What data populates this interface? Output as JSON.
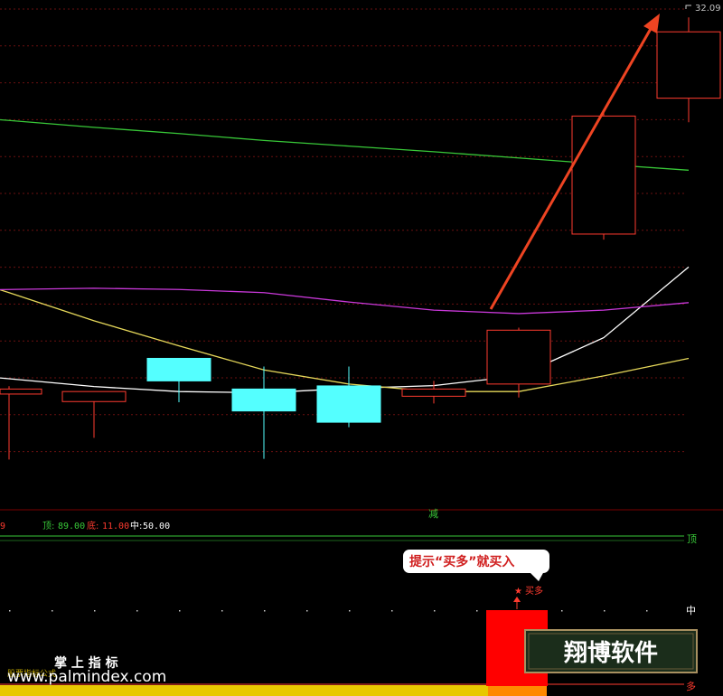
{
  "price_axis": {
    "top_value": "32.09"
  },
  "signal_bar": {
    "partial_value": "9",
    "peak_label": "顶:",
    "peak_value": "89.00",
    "bottom_label": "底:",
    "bottom_value": "11.00",
    "mid_label": "中:",
    "mid_value": "50.00"
  },
  "reduce_marker": "减",
  "right_labels": {
    "top": "顶",
    "mid": "中",
    "bottom": "多"
  },
  "callout": {
    "text": "提示“买多”就买入"
  },
  "buy_signal": {
    "star": "★",
    "label": "买多"
  },
  "watermark": {
    "title": "掌 上 指 标",
    "url": "www.palmindex.com",
    "brand": "翔博软件",
    "hidden_label": "股票指标公式"
  },
  "colors": {
    "background": "#000000",
    "up_candle": "#ff3b2f",
    "down_candle": "#54ffff",
    "ma_white": "#ffffff",
    "ma_yellow": "#e6d85a",
    "ma_purple": "#c838d8",
    "ma_green": "#38c838",
    "arrow": "#ee4422",
    "grid": "#6a1010",
    "buy_bar": "#ff0000"
  },
  "chart_data": {
    "type": "candlestick",
    "candles": [
      {
        "o": 20.06,
        "h": 20.31,
        "l": 17.97,
        "c": 20.22
      },
      {
        "o": 19.82,
        "h": 20.14,
        "l": 18.66,
        "c": 20.14
      },
      {
        "o": 21.2,
        "h": 21.2,
        "l": 19.8,
        "c": 20.48
      },
      {
        "o": 20.22,
        "h": 20.94,
        "l": 17.99,
        "c": 19.52
      },
      {
        "o": 20.32,
        "h": 20.94,
        "l": 19.0,
        "c": 19.16
      },
      {
        "o": 19.99,
        "h": 20.48,
        "l": 19.76,
        "c": 20.22
      },
      {
        "o": 20.38,
        "h": 22.18,
        "l": 19.95,
        "c": 22.1
      },
      {
        "o": 25.17,
        "h": 29.09,
        "l": 24.99,
        "c": 28.94
      },
      {
        "o": 29.51,
        "h": 32.09,
        "l": 28.74,
        "c": 31.63
      }
    ],
    "moving_averages": [
      {
        "name": "",
        "color": "ma_white",
        "values": [
          20.55,
          20.3,
          20.14,
          20.1,
          20.24,
          20.33,
          20.64,
          21.86,
          24.12
        ]
      },
      {
        "name": "",
        "color": "ma_yellow",
        "values": [
          23.3,
          22.4,
          21.6,
          20.83,
          20.38,
          20.14,
          20.14,
          20.64,
          21.2
        ]
      },
      {
        "name": "",
        "color": "ma_purple",
        "values": [
          23.4,
          23.44,
          23.4,
          23.3,
          23.0,
          22.74,
          22.63,
          22.74,
          22.98
        ]
      },
      {
        "name": "",
        "color": "ma_green",
        "values": [
          28.8,
          28.58,
          28.38,
          28.16,
          27.98,
          27.8,
          27.6,
          27.4,
          27.21
        ]
      }
    ],
    "ylim": [
      17.2,
      32.3
    ],
    "indicator_levels": {
      "top": 89.0,
      "bottom": 11.0,
      "middle": 50.0
    }
  }
}
